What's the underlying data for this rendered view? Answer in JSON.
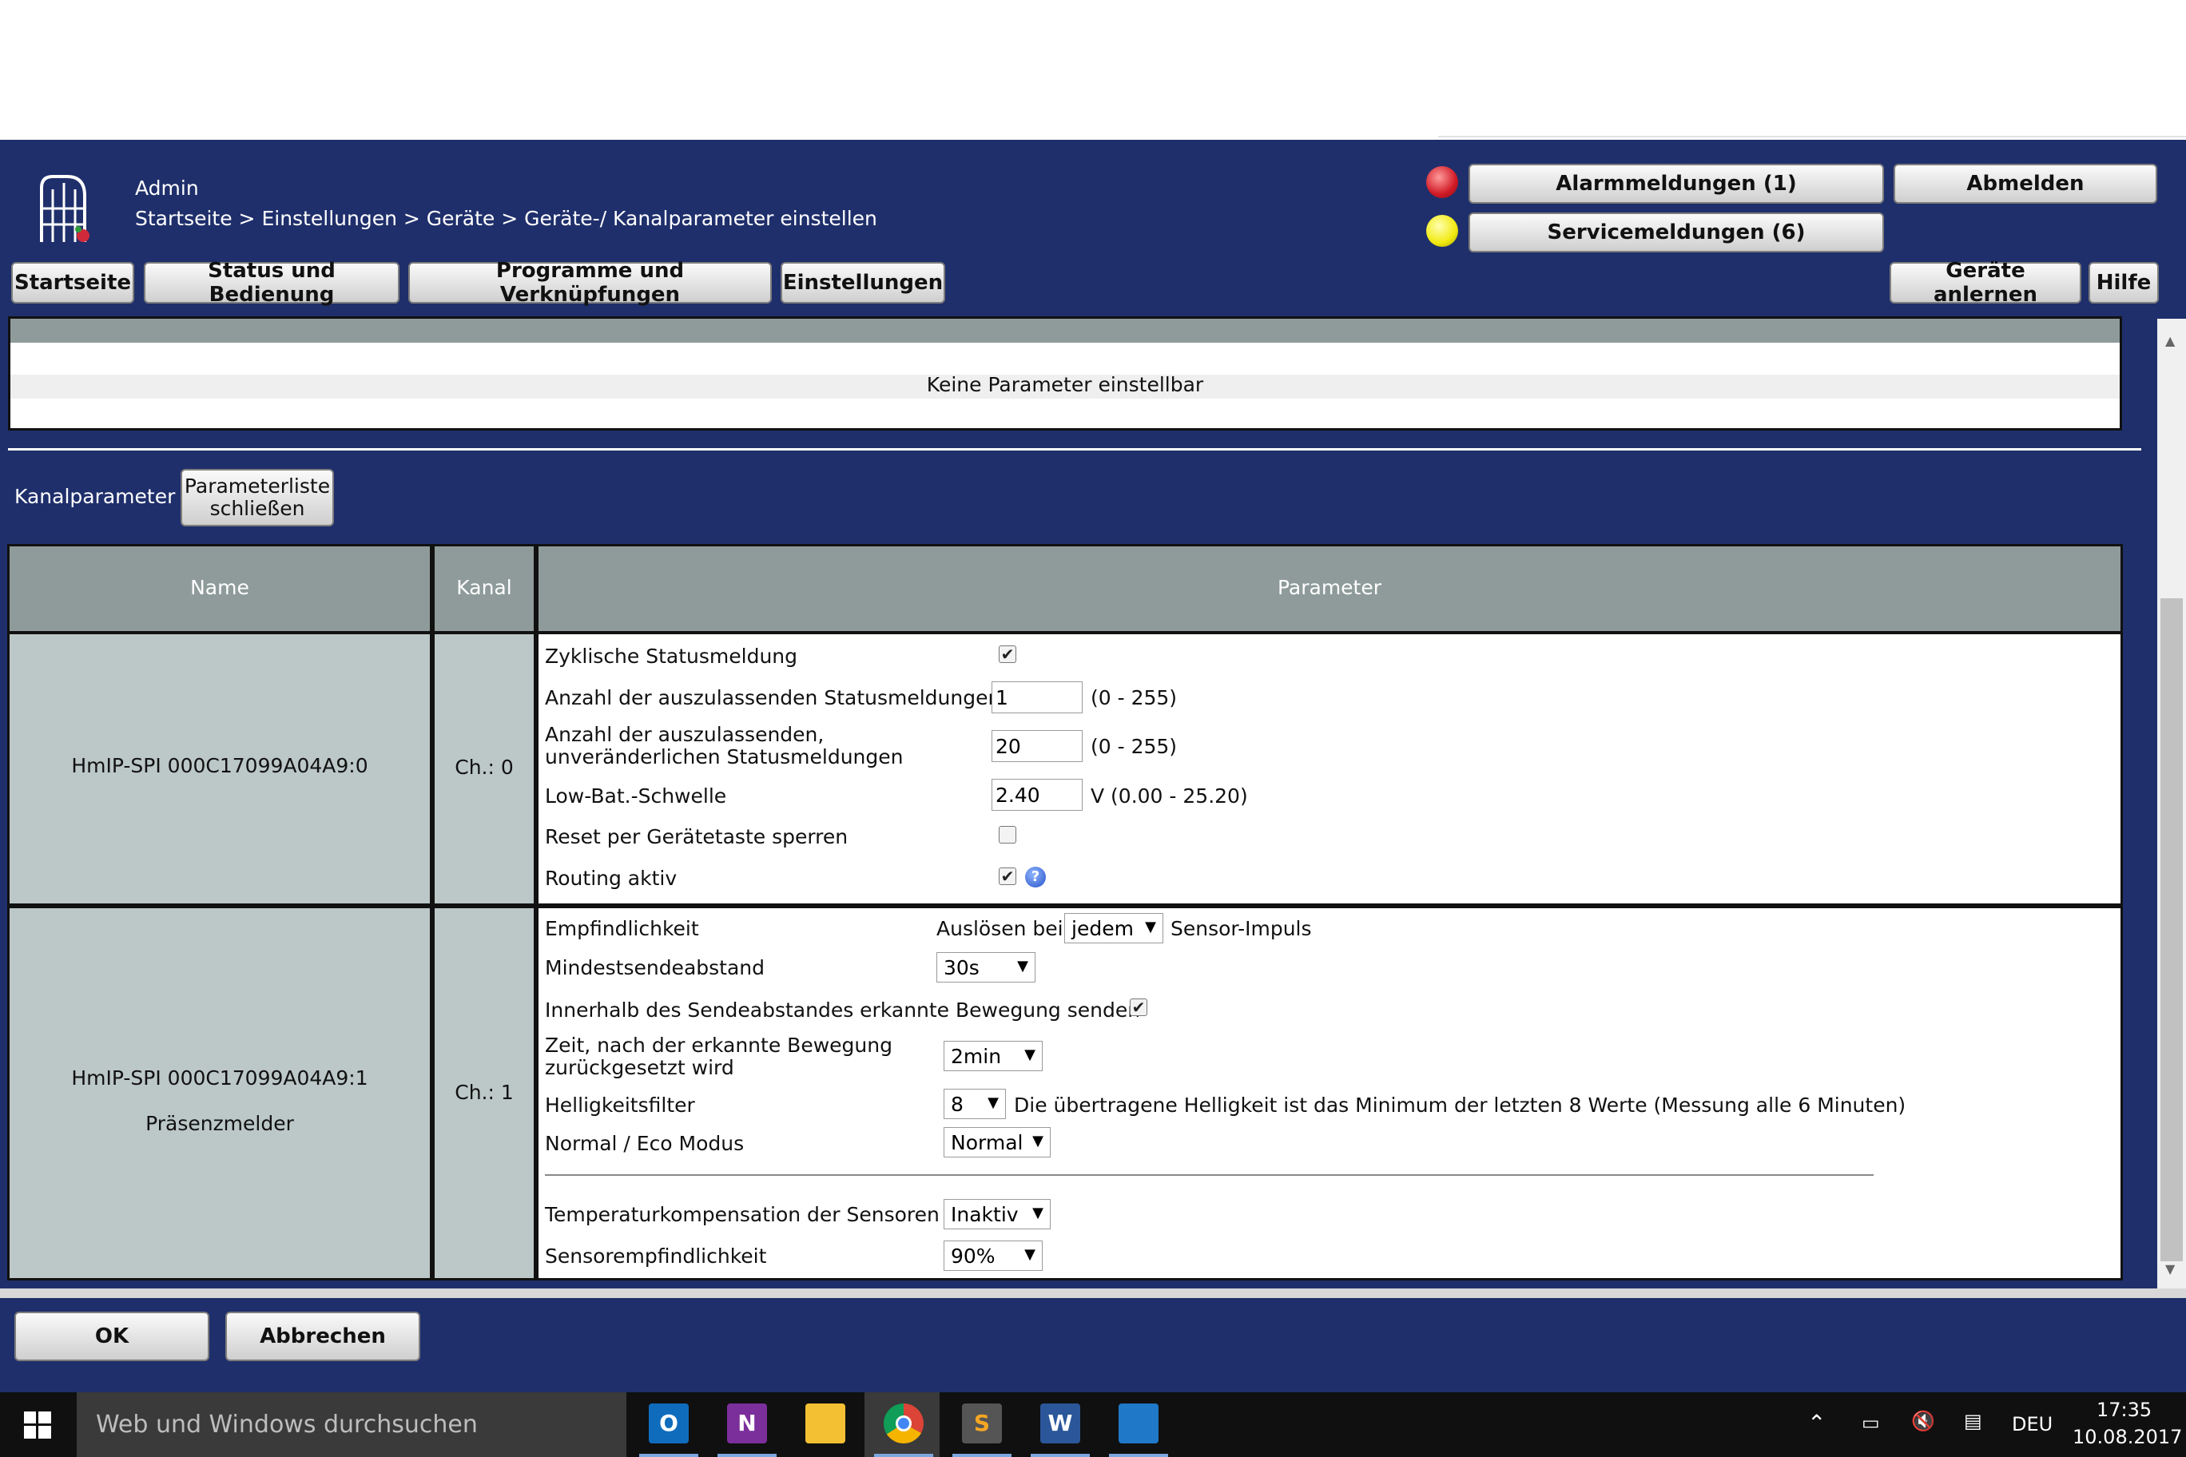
{
  "header": {
    "user": "Admin",
    "breadcrumb": "Startseite > Einstellungen > Geräte > Geräte-/ Kanalparameter einstellen",
    "alarm_button": "Alarmmeldungen (1)",
    "service_button": "Servicemeldungen (6)",
    "logout_button": "Abmelden",
    "nav": [
      "Startseite",
      "Status und Bedienung",
      "Programme und Verknüpfungen",
      "Einstellungen"
    ],
    "learn_button": "Geräte anlernen",
    "help_button": "Hilfe",
    "colors": {
      "bg": "#1f2f6b",
      "alarm_led": "#e0202a",
      "service_led": "#f4ee12"
    }
  },
  "device_panel": {
    "message": "Keine Parameter einstellbar"
  },
  "channel": {
    "label": "Kanalparameter",
    "close_button": "Parameterliste schließen",
    "columns": [
      "Name",
      "Kanal",
      "Parameter"
    ]
  },
  "rows": [
    {
      "name": "HmIP-SPI 000C17099A04A9:0",
      "kanal": "Ch.: 0",
      "zyklisch": {
        "label": "Zyklische Statusmeldung",
        "checked": true
      },
      "anzahl1": {
        "label": "Anzahl der auszulassenden Statusmeldungen",
        "value": "1",
        "range": "(0 - 255)"
      },
      "anzahl2": {
        "label_line1": "Anzahl der auszulassenden,",
        "label_line2": "unveränderlichen Statusmeldungen",
        "value": "20",
        "range": "(0 - 255)"
      },
      "lowbat": {
        "label": "Low-Bat.-Schwelle",
        "value": "2.40",
        "range": "V (0.00 - 25.20)"
      },
      "reset": {
        "label": "Reset per Gerätetaste sperren",
        "checked": false
      },
      "routing": {
        "label": "Routing aktiv",
        "checked": true
      }
    },
    {
      "name": "HmIP-SPI 000C17099A04A9:1",
      "subtitle": "Präsenzmelder",
      "kanal": "Ch.: 1",
      "empf": {
        "label": "Empfindlichkeit",
        "prefix": "Auslösen bei",
        "value": "jedem",
        "suffix": "Sensor-Impuls"
      },
      "mindest": {
        "label": "Mindestsendeabstand",
        "value": "30s"
      },
      "innerhalb": {
        "label": "Innerhalb des Sendeabstandes erkannte Bewegung senden",
        "checked": true
      },
      "zeit": {
        "label_line1": "Zeit, nach der erkannte Bewegung",
        "label_line2": "zurückgesetzt wird",
        "value": "2min"
      },
      "hell": {
        "label": "Helligkeitsfilter",
        "value": "8",
        "note": "Die übertragene Helligkeit ist das Minimum der letzten 8 Werte (Messung alle 6 Minuten)"
      },
      "eco": {
        "label": "Normal / Eco Modus",
        "value": "Normal"
      },
      "temp": {
        "label": "Temperaturkompensation der Sensoren",
        "value": "Inaktiv"
      },
      "sens": {
        "label": "Sensorempfindlichkeit",
        "value": "90%"
      }
    }
  ],
  "footer": {
    "ok_button": "OK",
    "cancel_button": "Abbrechen"
  },
  "taskbar": {
    "search_placeholder": "Web und Windows durchsuchen",
    "language": "DEU",
    "time": "17:35",
    "date": "10.08.2017"
  }
}
